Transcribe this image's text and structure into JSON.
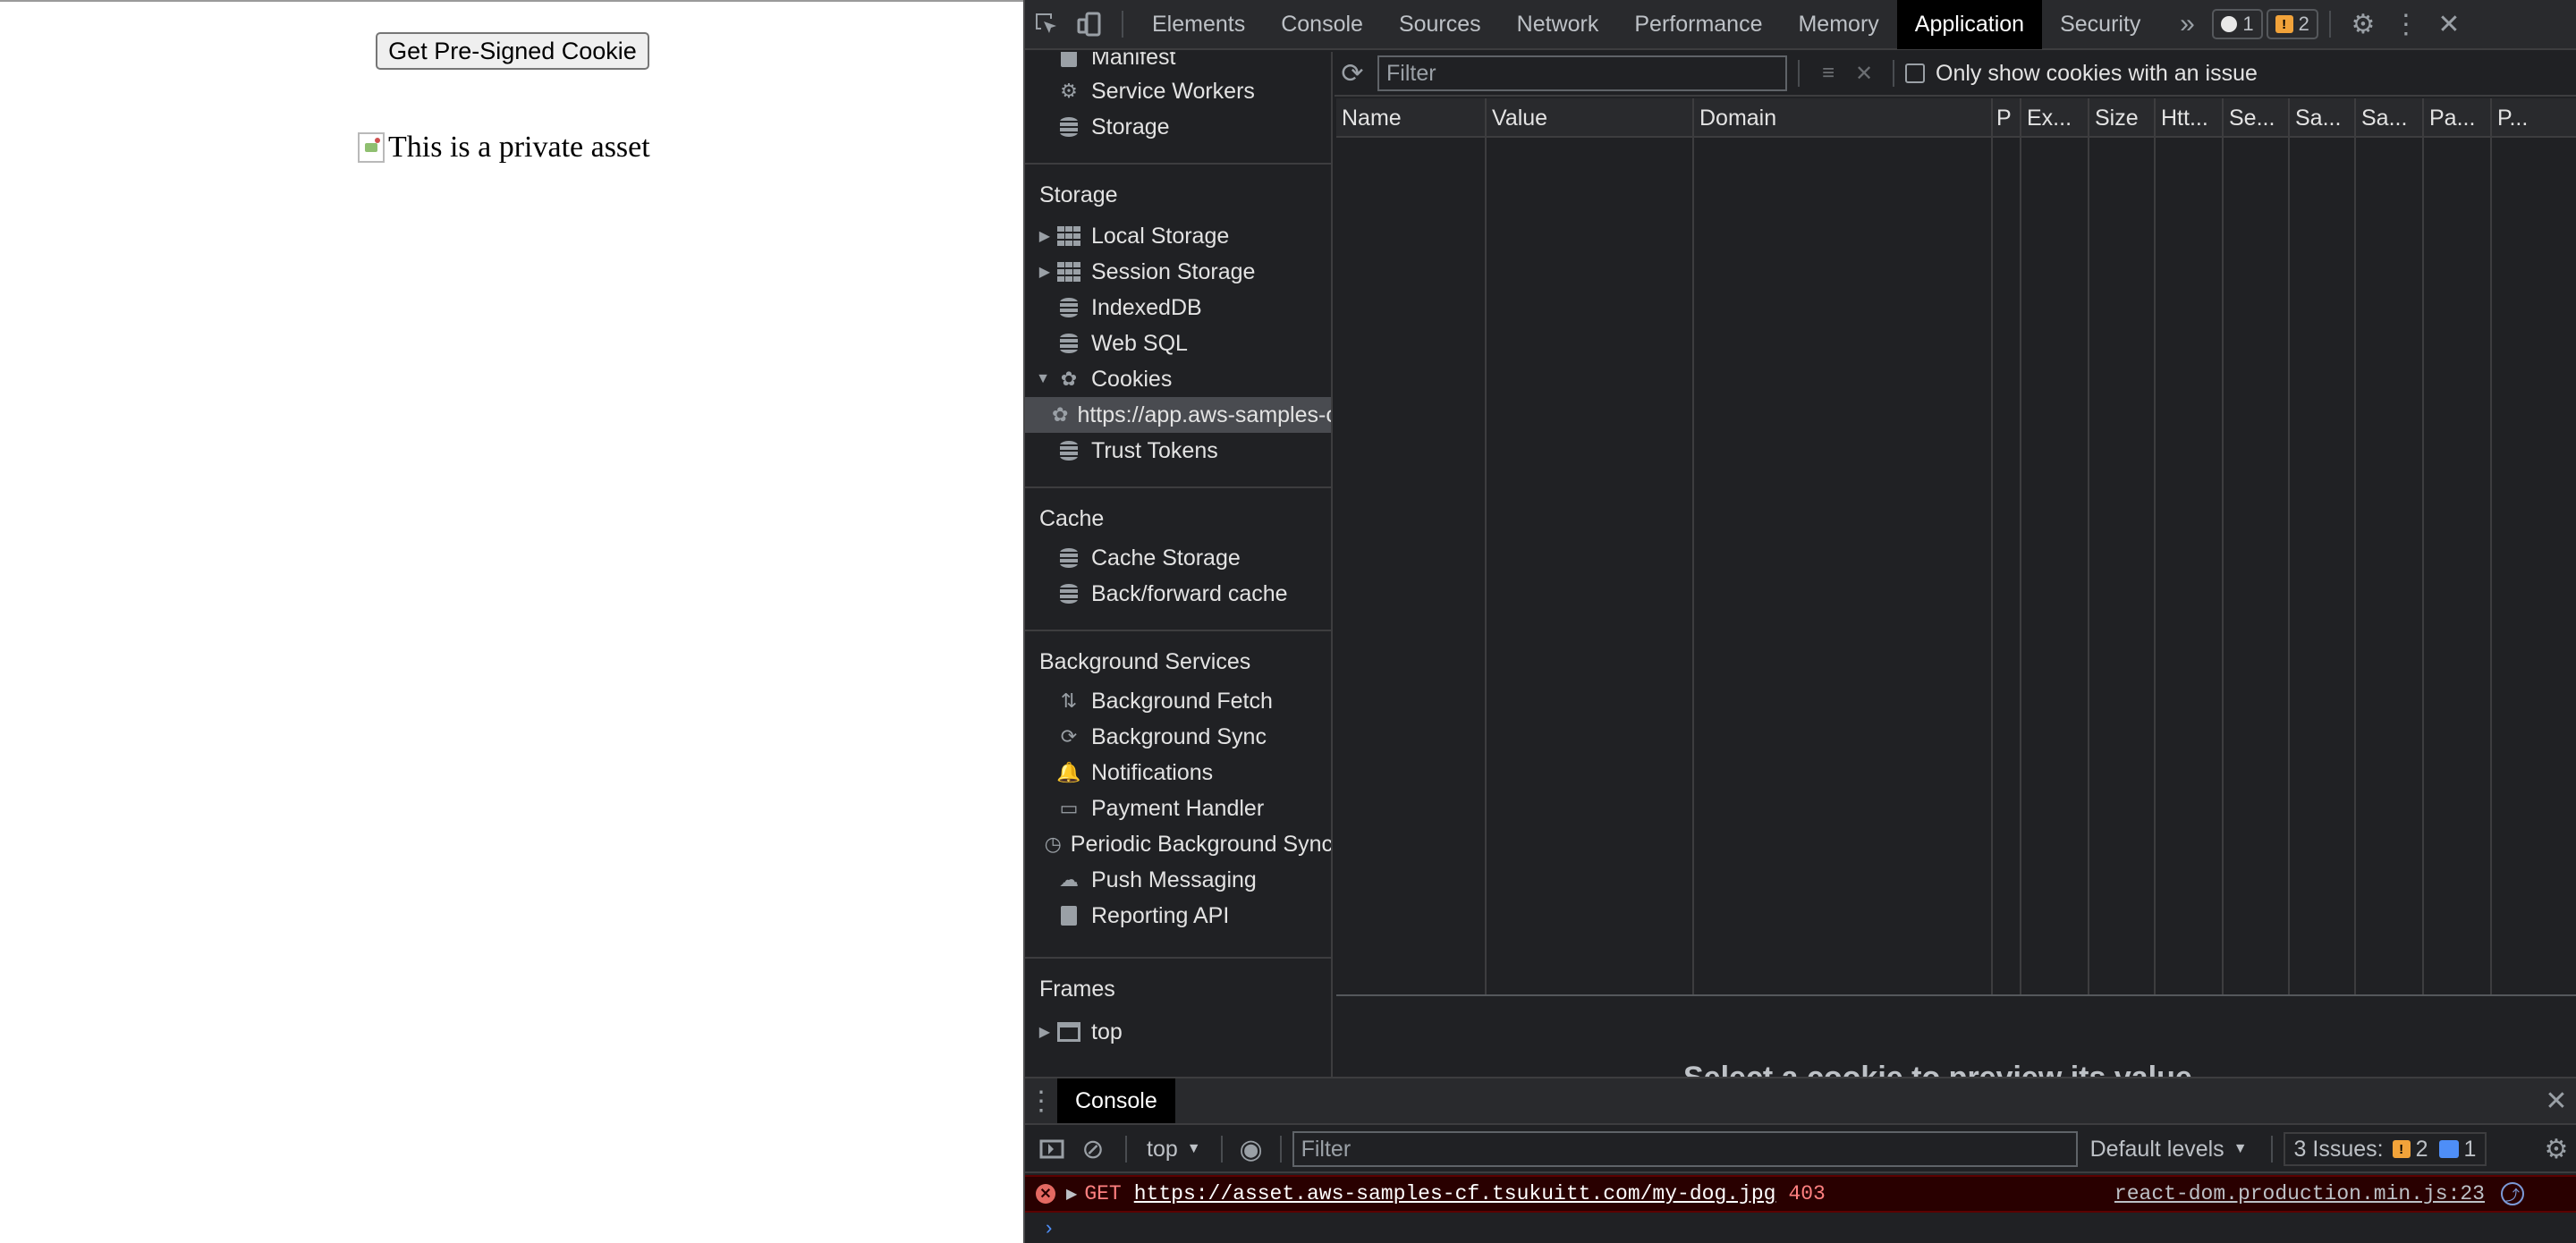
{
  "page": {
    "cookie_button": "Get Pre-Signed Cookie",
    "image_alt": "This is a private asset"
  },
  "devtools": {
    "tabs": [
      "Elements",
      "Console",
      "Sources",
      "Network",
      "Performance",
      "Memory",
      "Application",
      "Security"
    ],
    "active_tab": "Application",
    "issue_badges": {
      "info_count": "1",
      "warning_count": "2"
    },
    "sidebar": {
      "partial_top": [
        "Manifest",
        "Service Workers",
        "Storage"
      ],
      "storage_title": "Storage",
      "storage_items": [
        "Local Storage",
        "Session Storage",
        "IndexedDB",
        "Web SQL",
        "Cookies"
      ],
      "cookie_child": "https://app.aws-samples-cf.tsukuitt.com",
      "trust_tokens": "Trust Tokens",
      "cache_title": "Cache",
      "cache_items": [
        "Cache Storage",
        "Back/forward cache"
      ],
      "background_title": "Background Services",
      "background_items": [
        "Background Fetch",
        "Background Sync",
        "Notifications",
        "Payment Handler",
        "Periodic Background Sync",
        "Push Messaging",
        "Reporting API"
      ],
      "frames_title": "Frames",
      "frames_items": [
        "top"
      ]
    },
    "cookie_toolbar": {
      "filter_placeholder": "Filter",
      "issue_checkbox_label": "Only show cookies with an issue"
    },
    "cookie_columns": [
      "Name",
      "Value",
      "Domain",
      "P",
      "Ex...",
      "Size",
      "Htt...",
      "Se...",
      "Sa...",
      "Sa...",
      "Pa...",
      "P..."
    ],
    "preview_text": "Select a cookie to preview its value",
    "console": {
      "drawer_tab": "Console",
      "context": "top",
      "filter_placeholder": "Filter",
      "levels": "Default levels",
      "issues_label": "3 Issues:",
      "issues_warn": "2",
      "issues_info": "1",
      "error": {
        "method": "GET",
        "url": "https://asset.aws-samples-cf.tsukuitt.com/my-dog.jpg",
        "status": "403",
        "source": "react-dom.production.min.js:23"
      }
    }
  }
}
